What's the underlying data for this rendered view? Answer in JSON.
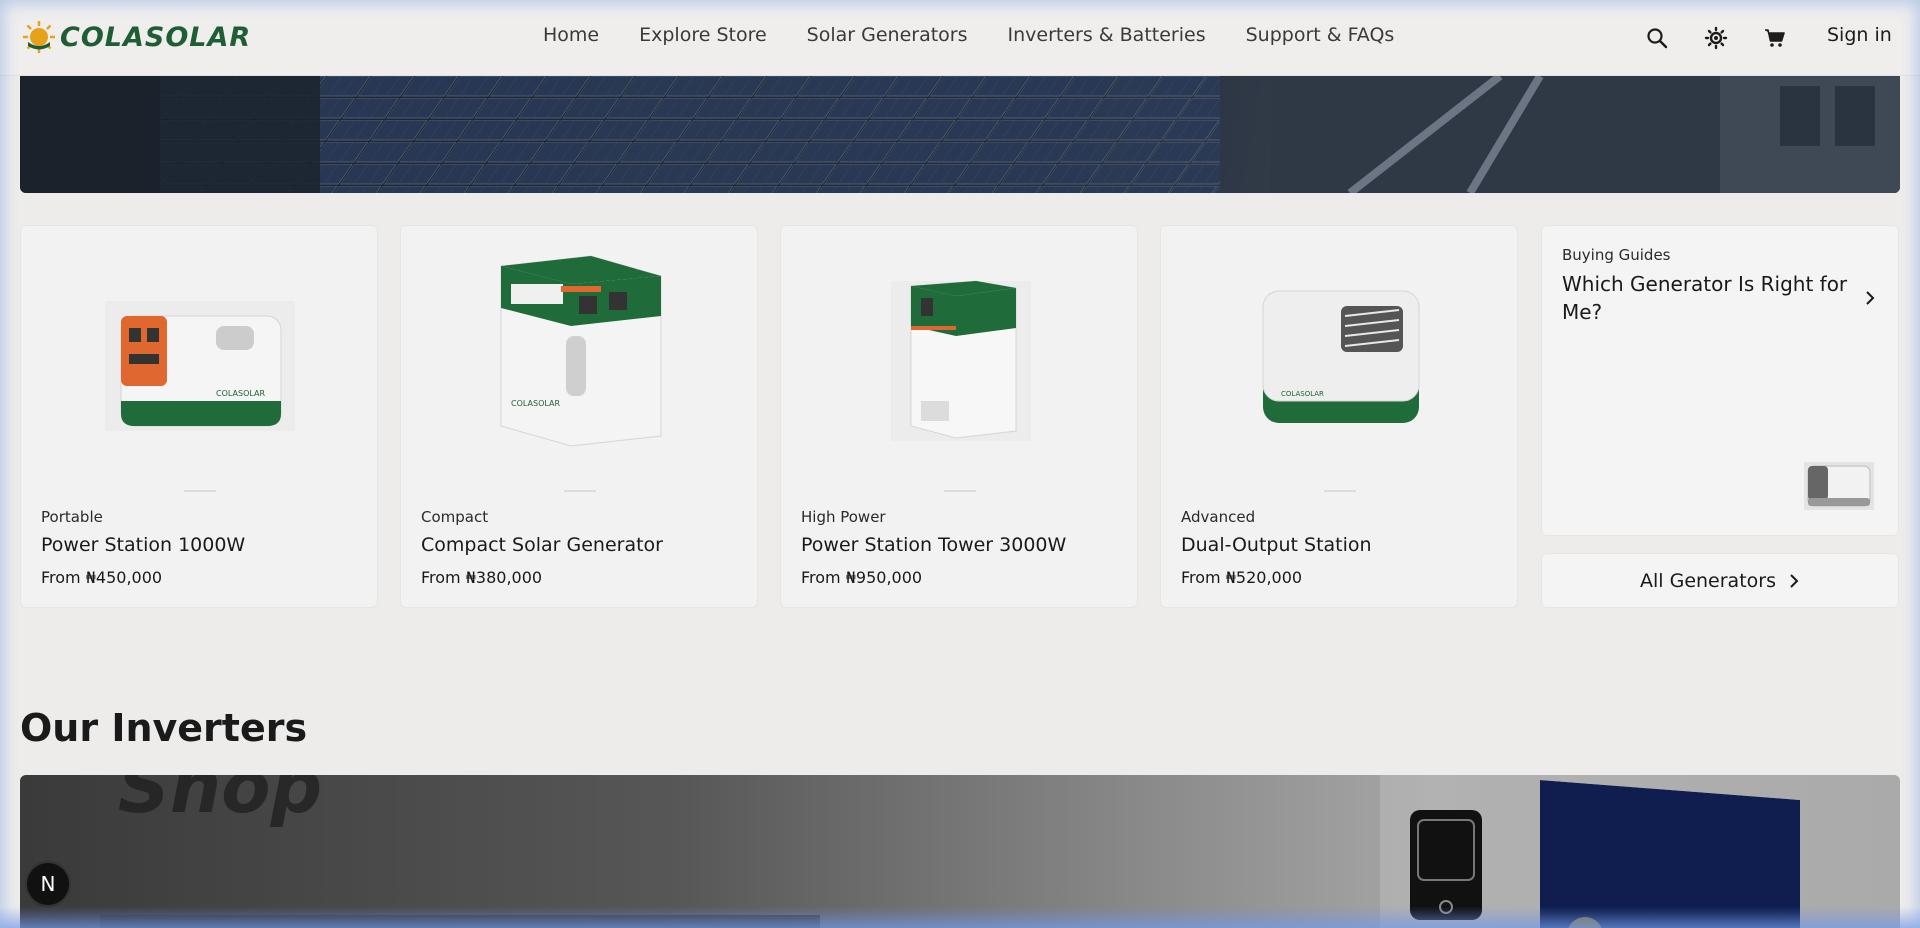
{
  "header": {
    "brand": "COLASOLAR",
    "nav": [
      "Home",
      "Explore Store",
      "Solar Generators",
      "Inverters & Batteries",
      "Support & FAQs"
    ],
    "signin": "Sign in",
    "icons": [
      "search-icon",
      "theme-toggle-icon",
      "cart-icon"
    ]
  },
  "products": [
    {
      "category": "Portable",
      "name": "Power Station 1000W",
      "price": "From ₦450,000"
    },
    {
      "category": "Compact",
      "name": "Compact Solar Generator",
      "price": "From ₦380,000"
    },
    {
      "category": "High Power",
      "name": "Power Station Tower 3000W",
      "price": "From ₦950,000"
    },
    {
      "category": "Advanced",
      "name": "Dual-Output Station",
      "price": "From ₦520,000"
    }
  ],
  "guide": {
    "category": "Buying Guides",
    "title": "Which Generator Is Right for Me?"
  },
  "all_generators": "All Generators",
  "inverters": {
    "section_title": "Our Inverters",
    "banner_word": "Shop"
  },
  "badge": "N",
  "colors": {
    "brand_green": "#1f5e35",
    "accent_orange": "#e0772f",
    "sun_yellow": "#e8a21a"
  }
}
